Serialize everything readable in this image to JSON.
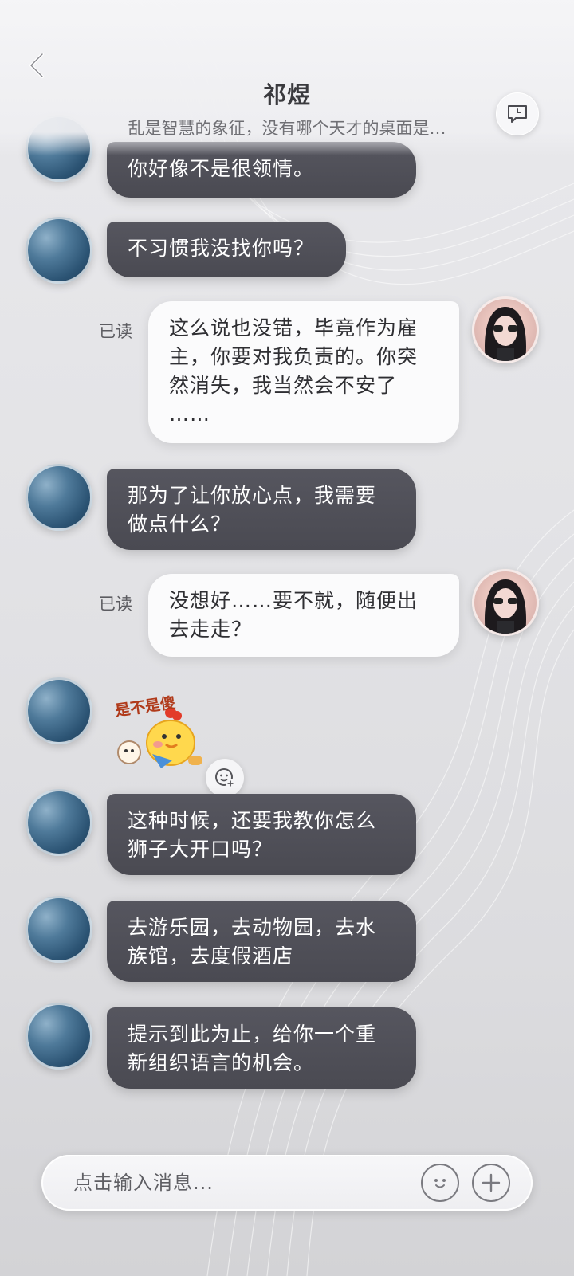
{
  "header": {
    "title": "祁煜",
    "subtitle": "乱是智慧的象征，没有哪个天才的桌面是…",
    "back_icon": "chevron-left-icon",
    "history_icon": "chat-clock-icon"
  },
  "messages": [
    {
      "side": "left",
      "type": "text",
      "text": "你好像不是很领情。"
    },
    {
      "side": "left",
      "type": "text",
      "text": "不习惯我没找你吗？"
    },
    {
      "side": "right",
      "type": "text",
      "status": "已读",
      "lines": [
        "这么说也没错，毕竟作为雇",
        "主，你要对我负责的。你突",
        "然消失，我当然会不安了",
        "……"
      ]
    },
    {
      "side": "left",
      "type": "text",
      "lines": [
        "那为了让你放心点，我需要",
        "做点什么？"
      ]
    },
    {
      "side": "right",
      "type": "text",
      "status": "已读",
      "lines": [
        "没想好……要不就，随便出",
        "去走走？"
      ]
    },
    {
      "side": "left",
      "type": "sticker",
      "sticker_text": "是不是傻",
      "sticker_icon": "duck-sticker-icon"
    },
    {
      "side": "left",
      "type": "text",
      "lines": [
        "这种时候，还要我教你怎么",
        "狮子大开口吗？"
      ]
    },
    {
      "side": "left",
      "type": "text",
      "lines": [
        "去游乐园，去动物园，去水",
        "族馆，去度假酒店"
      ]
    },
    {
      "side": "left",
      "type": "text",
      "lines": [
        "提示到此为止，给你一个重",
        "新组织语言的机会。"
      ]
    }
  ],
  "input": {
    "placeholder": "点击输入消息...",
    "emoji_icon": "emoji-icon",
    "plus_icon": "plus-icon"
  },
  "colors": {
    "left_bubble": "#4f4f57",
    "right_bubble": "#fbfbfc",
    "background": "#e4e4e7"
  }
}
